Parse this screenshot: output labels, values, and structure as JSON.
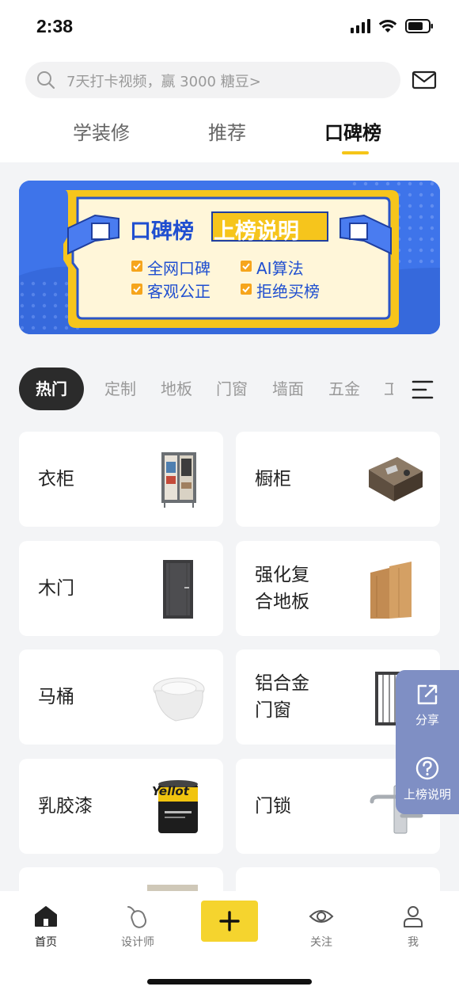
{
  "status_bar": {
    "time": "2:38"
  },
  "search": {
    "placeholder": "7天打卡视频，赢 3000 糖豆>"
  },
  "top_tabs": [
    {
      "label": "学装修"
    },
    {
      "label": "推荐"
    },
    {
      "label": "口碑榜",
      "active": true
    }
  ],
  "banner": {
    "title_left": "口碑榜",
    "title_right": "上榜说明",
    "points": [
      "全网口碑",
      "AI算法",
      "客观公正",
      "拒绝买榜"
    ]
  },
  "categories": [
    {
      "label": "热门",
      "active": true
    },
    {
      "label": "定制"
    },
    {
      "label": "地板"
    },
    {
      "label": "门窗"
    },
    {
      "label": "墙面"
    },
    {
      "label": "五金"
    },
    {
      "label": "工"
    }
  ],
  "cards": [
    {
      "line1": "衣柜",
      "line2": "",
      "image": "wardrobe"
    },
    {
      "line1": "橱柜",
      "line2": "",
      "image": "cabinet"
    },
    {
      "line1": "木门",
      "line2": "",
      "image": "wooden-door"
    },
    {
      "line1": "强化复",
      "line2": "合地板",
      "image": "laminate-floor"
    },
    {
      "line1": "马桶",
      "line2": "",
      "image": "toilet"
    },
    {
      "line1": "铝合金",
      "line2": "门窗",
      "image": "aluminum-window"
    },
    {
      "line1": "乳胶漆",
      "line2": "",
      "image": "paint-bucket",
      "image_text": "Yellot"
    },
    {
      "line1": "门锁",
      "line2": "",
      "image": "door-lock"
    }
  ],
  "float_panel": {
    "share_label": "分享",
    "explain_label": "上榜说明"
  },
  "bottom_nav": [
    {
      "label": "首页",
      "icon": "home-icon",
      "active": true
    },
    {
      "label": "设计师",
      "icon": "mouse-icon"
    },
    {
      "label": "",
      "icon": "plus-icon"
    },
    {
      "label": "关注",
      "icon": "eye-icon"
    },
    {
      "label": "我",
      "icon": "user-icon"
    }
  ],
  "colors": {
    "accent_yellow": "#f5d42e",
    "banner_blue": "#3e74ea",
    "float_panel": "#7f8fc4"
  }
}
